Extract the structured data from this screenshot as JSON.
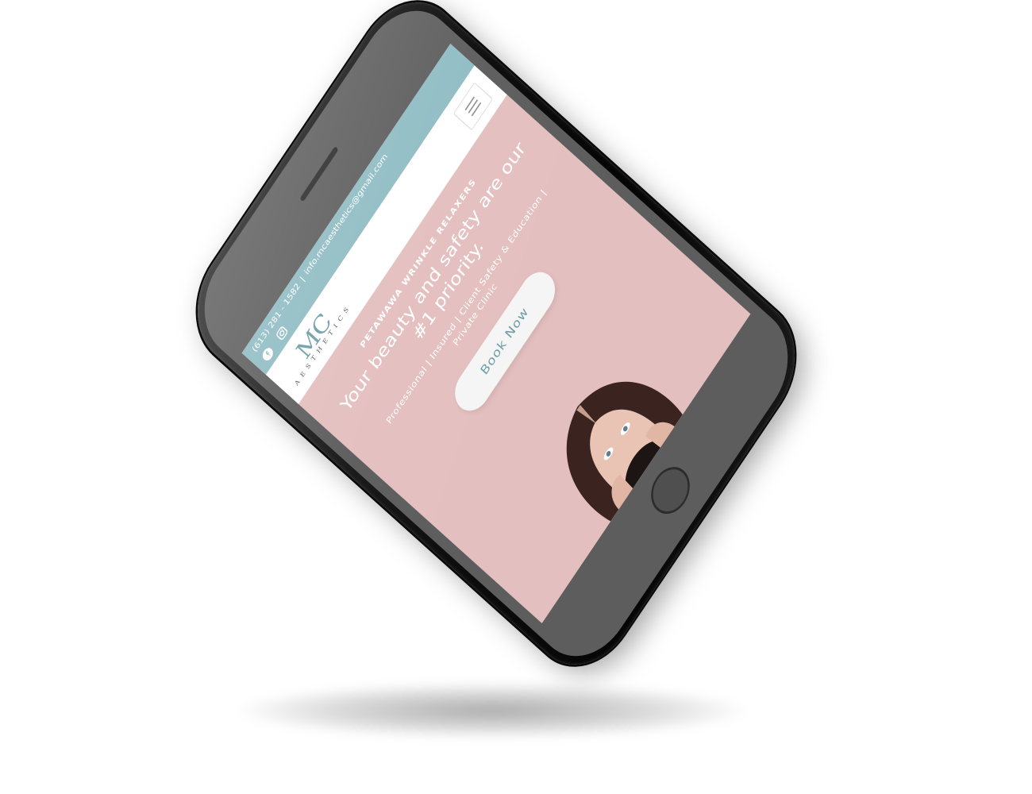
{
  "topbar": {
    "phone": "(613) 281 - 1582",
    "separator": "|",
    "email": "info.mcaesthetics@gmail.com",
    "icons": [
      "facebook-icon",
      "instagram-icon"
    ],
    "background_color": "#8fbcc3"
  },
  "header": {
    "logo_mark": "MC",
    "logo_sub": "AESTHETICS",
    "menu_icon": "hamburger-icon"
  },
  "hero": {
    "eyebrow": "PETAWAWA WRINKLE RELAXERS",
    "headline": "Your beauty and safety are our #1 priority.",
    "subline": "Professional | Insured | Client Safety & Education | Private Clinic",
    "cta_label": "Book Now",
    "background_color": "#e4bfbf",
    "accent_color": "#6d9ea7"
  }
}
